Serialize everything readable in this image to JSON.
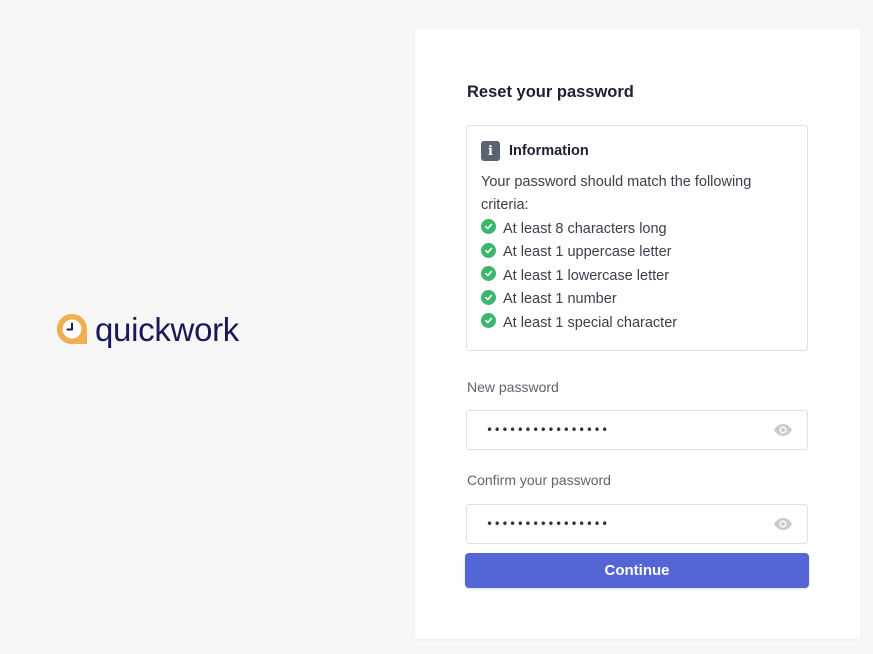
{
  "brand": {
    "name": "quickwork",
    "logo_icon": "clock-bubble-icon",
    "logo_color": "#f0ae4c",
    "text_color": "#18195a"
  },
  "card": {
    "title": "Reset your password",
    "info": {
      "icon": "info-icon",
      "badge_text": "i",
      "title": "Information",
      "description": "Your password should match the following criteria:",
      "criteria": [
        {
          "label": "At least 8 characters long",
          "icon": "check-circle-icon"
        },
        {
          "label": "At least 1 uppercase letter",
          "icon": "check-circle-icon"
        },
        {
          "label": "At least 1 lowercase letter",
          "icon": "check-circle-icon"
        },
        {
          "label": "At least 1 number",
          "icon": "check-circle-icon"
        },
        {
          "label": "At least 1 special character",
          "icon": "check-circle-icon"
        }
      ]
    },
    "new_password": {
      "label": "New password",
      "value": "••••••••••••••••",
      "toggle_icon": "eye-icon"
    },
    "confirm_password": {
      "label": "Confirm your password",
      "value": "••••••••••••••••",
      "toggle_icon": "eye-icon"
    },
    "submit_label": "Continue"
  },
  "colors": {
    "accent": "#5466d6",
    "success": "#3cb66a",
    "page_background": "#f7f7f7"
  }
}
